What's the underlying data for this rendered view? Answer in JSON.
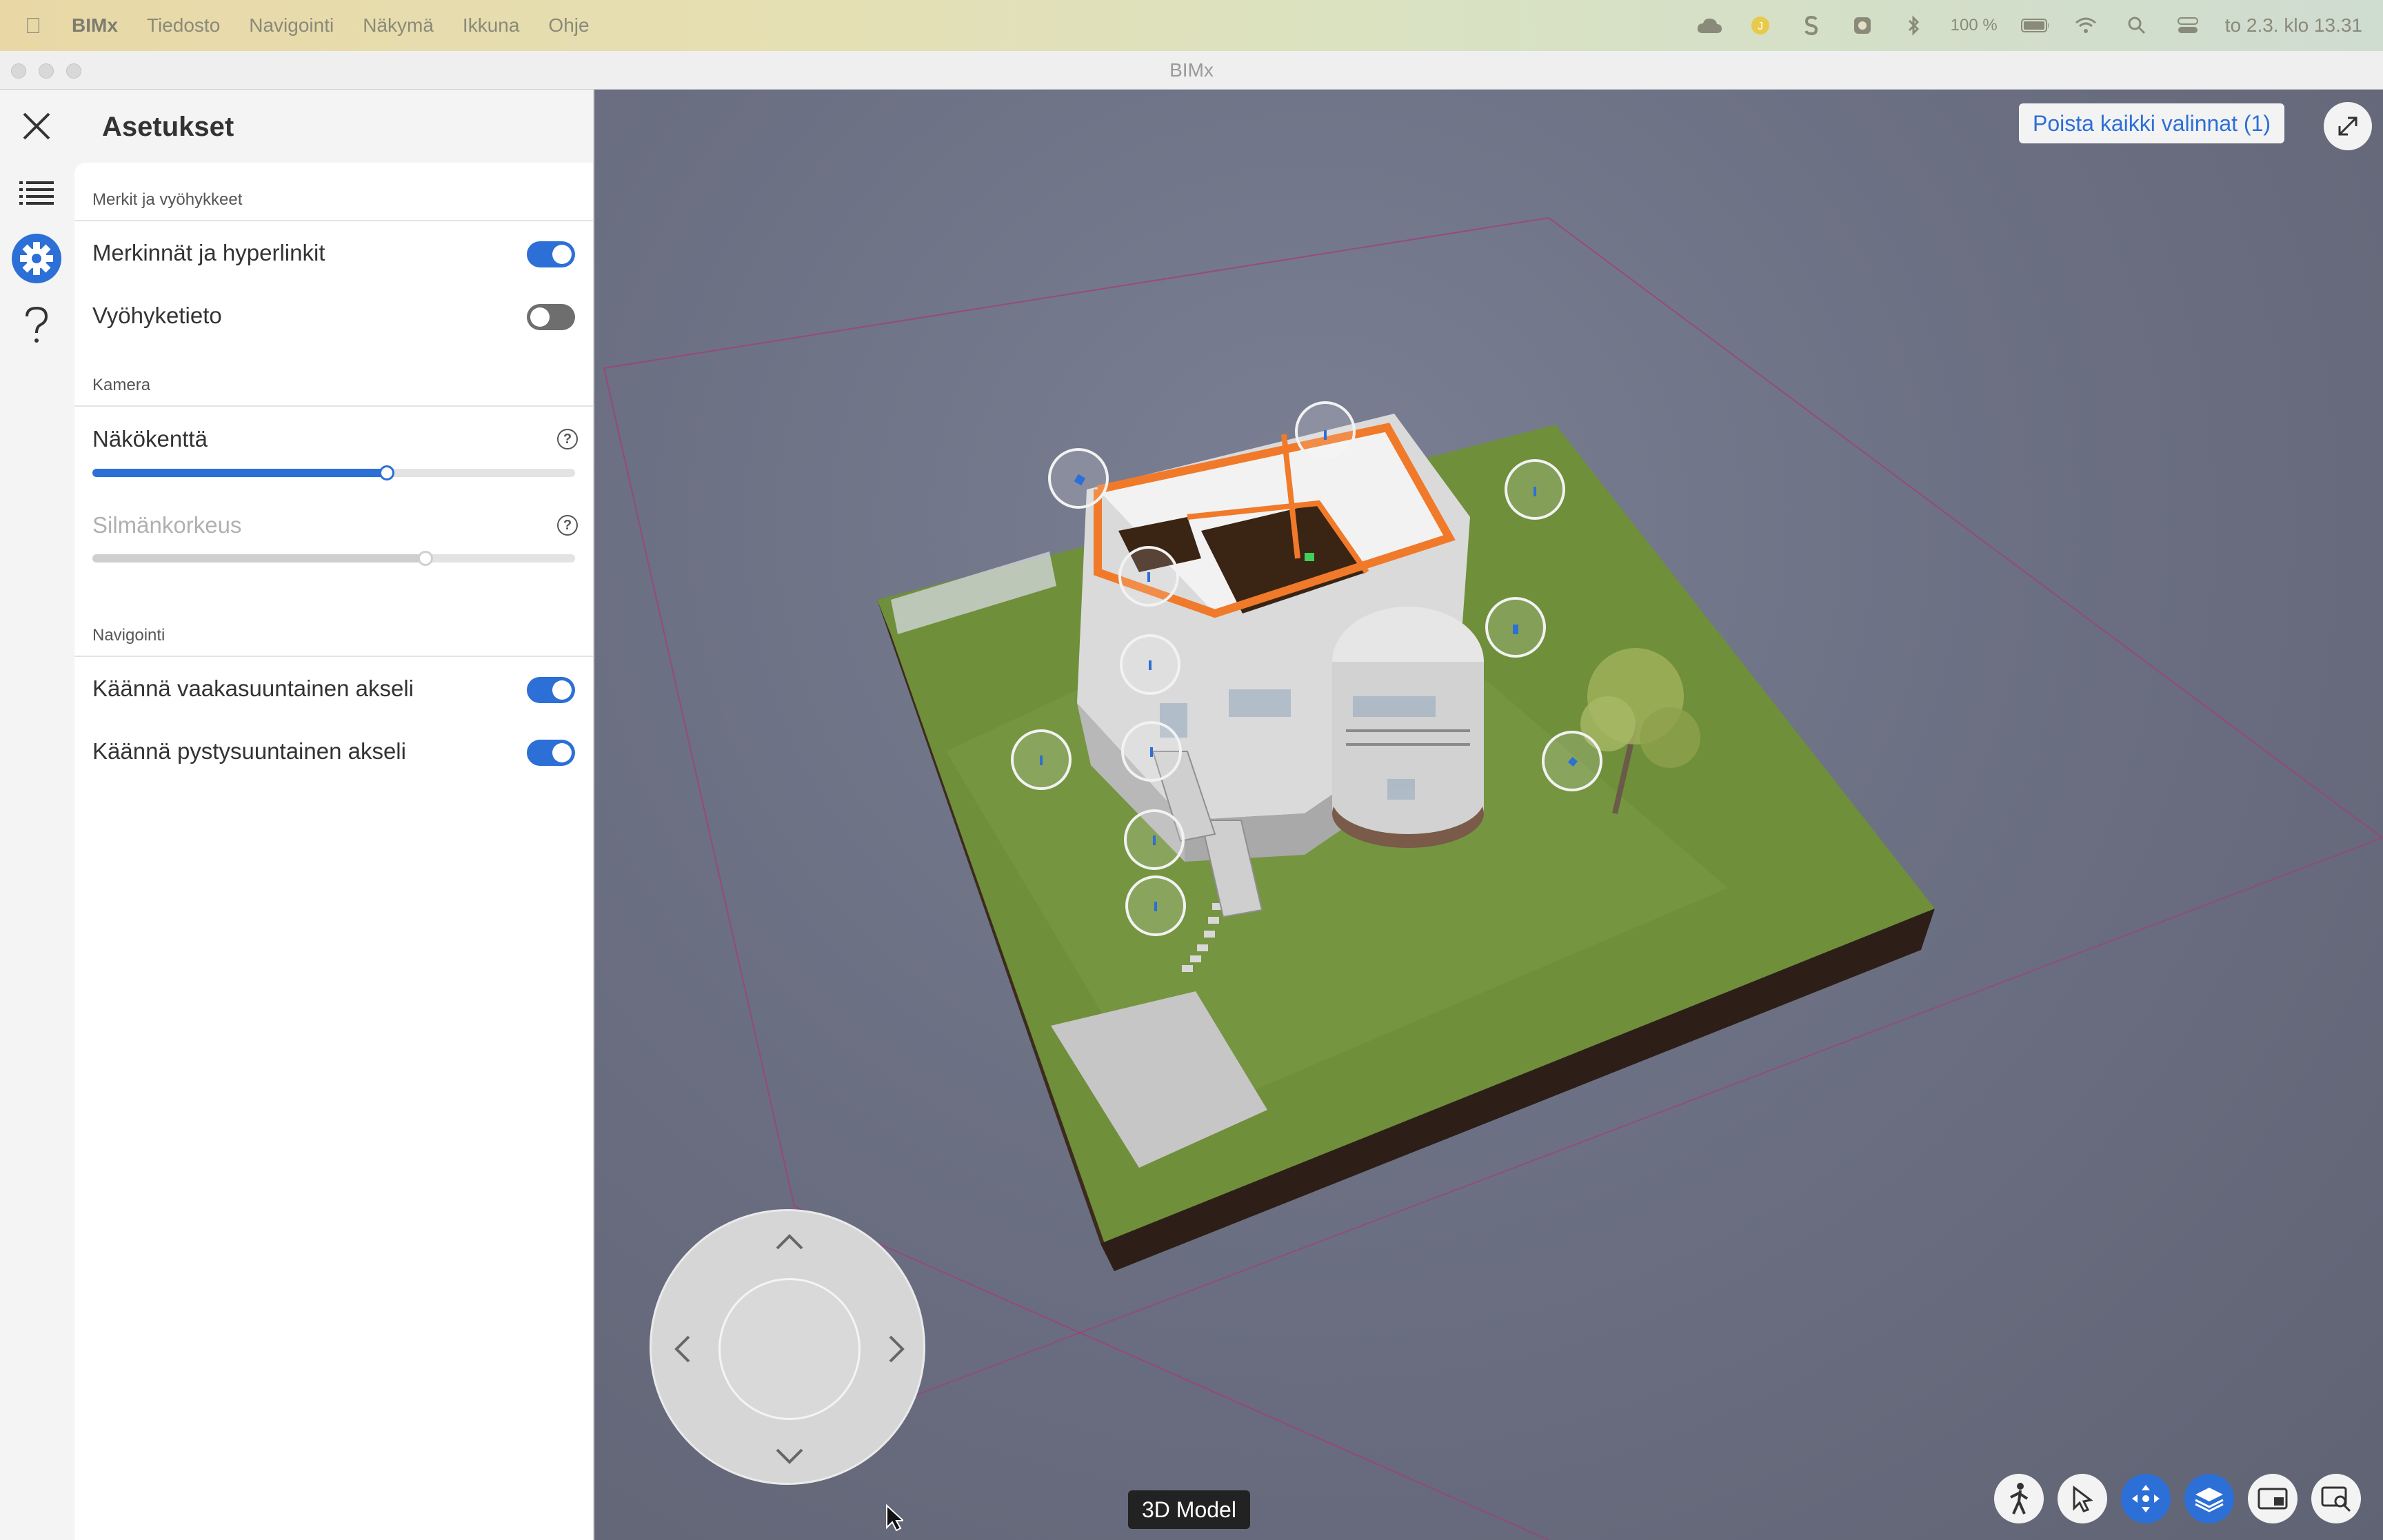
{
  "menubar": {
    "app_name": "BIMx",
    "items": [
      "Tiedosto",
      "Navigointi",
      "Näkymä",
      "Ikkuna",
      "Ohje"
    ],
    "battery": "100 %",
    "clock": "to 2.3. klo 13.31"
  },
  "window": {
    "title": "BIMx"
  },
  "settings": {
    "title": "Asetukset",
    "sections": {
      "markers": {
        "heading": "Merkit ja vyöhykkeet",
        "markup_label": "Merkinnät ja hyperlinkit",
        "markup_on": true,
        "zone_label": "Vyöhyketieto",
        "zone_on": false
      },
      "camera": {
        "heading": "Kamera",
        "fov_label": "Näkökenttä",
        "fov_level": 0.61,
        "eye_label": "Silmänkorkeus",
        "eye_level": 0.69
      },
      "navigation": {
        "heading": "Navigointi",
        "invert_h_label": "Käännä vaakasuuntainen akseli",
        "invert_h_on": true,
        "invert_v_label": "Käännä pystysuuntainen akseli",
        "invert_v_on": true
      }
    }
  },
  "viewport": {
    "clear_selection": "Poista kaikki valinnat (1)",
    "mode_label": "3D Model"
  },
  "colors": {
    "accent": "#2c6fd6",
    "grass": "#6f8f3a",
    "wall": "#e6e6e6",
    "highlight": "#f07a2a"
  }
}
